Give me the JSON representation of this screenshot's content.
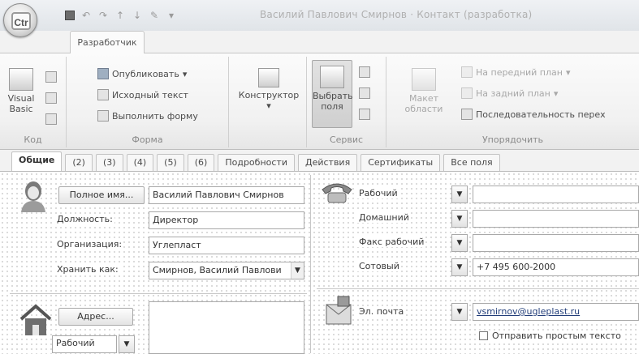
{
  "window": {
    "title": "Василий Павлович Смирнов · Контакт  (разработка)",
    "office_logo": "Ctr"
  },
  "quick_access": [
    "save-icon",
    "undo-icon",
    "redo-icon",
    "up-icon",
    "down-icon",
    "design-icon",
    "customize-icon"
  ],
  "ribbon": {
    "active_tab": "Разработчик",
    "groups": {
      "code": {
        "label": "Код",
        "visual_basic": "Visual Basic"
      },
      "form": {
        "label": "Форма",
        "publish": "Опубликовать",
        "source_text": "Исходный текст",
        "run_form": "Выполнить форму"
      },
      "tools": {
        "constructor": "Конструктор"
      },
      "service": {
        "label": "Сервис",
        "select_fields": "Выбрать поля"
      },
      "layout": {
        "field_layout": "Макет области",
        "bring_forward": "На передний план",
        "send_backward": "На задний план",
        "tab_order": "Последовательность перех",
        "label": "Упорядочить"
      }
    }
  },
  "form_tabs": [
    "Общие",
    "(2)",
    "(3)",
    "(4)",
    "(5)",
    "(6)",
    "Подробности",
    "Действия",
    "Сертификаты",
    "Все поля"
  ],
  "contact": {
    "full_name_button": "Полное имя...",
    "full_name": "Василий Павлович Смирнов",
    "job_title_label": "Должность:",
    "job_title": "Директор",
    "company_label": "Организация:",
    "company": "Углепласт",
    "file_as_label": "Хранить как:",
    "file_as": "Смирнов, Василий Павлови",
    "address_button": "Адрес...",
    "address_type": "Рабочий"
  },
  "phones": [
    {
      "label": "Рабочий",
      "value": ""
    },
    {
      "label": "Домашний",
      "value": ""
    },
    {
      "label": "Факс рабочий",
      "value": ""
    },
    {
      "label": "Сотовый",
      "value": "+7 495 600-2000"
    }
  ],
  "email": {
    "label": "Эл. почта",
    "value": "vsmirnov@ugleplast.ru",
    "plain_text_checkbox": "Отправить простым тексто"
  }
}
